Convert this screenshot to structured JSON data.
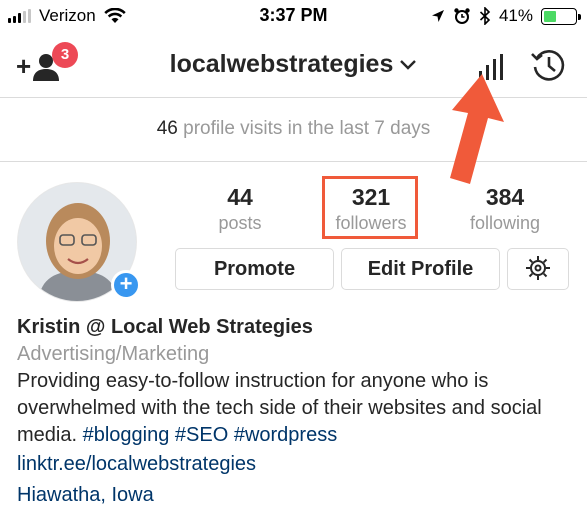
{
  "status_bar": {
    "carrier": "Verizon",
    "time": "3:37 PM",
    "battery_pct": "41%",
    "battery_level": 0.41,
    "battery_color": "#4cd964"
  },
  "nav": {
    "notification_count": "3",
    "username": "localwebstrategies"
  },
  "visits": {
    "count": "46",
    "label": " profile visits in the last 7 days"
  },
  "stats": {
    "posts": {
      "value": "44",
      "label": "posts"
    },
    "followers": {
      "value": "321",
      "label": "followers"
    },
    "following": {
      "value": "384",
      "label": "following"
    }
  },
  "buttons": {
    "promote": "Promote",
    "edit_profile": "Edit Profile"
  },
  "bio": {
    "name": "Kristin @ Local Web Strategies",
    "category": "Advertising/Marketing",
    "description": "Providing easy-to-follow instruction for anyone who is overwhelmed with the tech side of their websites and social media.",
    "hashtags": [
      "#blogging",
      "#SEO",
      "#wordpress"
    ],
    "link": "linktr.ee/localwebstrategies",
    "location": "Hiawatha, Iowa"
  },
  "colors": {
    "badge": "#ed4956",
    "link": "#003569",
    "highlight": "#f05a3a",
    "add_button": "#3897f0"
  },
  "icons": [
    "signal-icon",
    "wifi-icon",
    "location-arrow-icon",
    "alarm-icon",
    "bluetooth-icon",
    "battery-icon",
    "add-user-icon",
    "chevron-down-icon",
    "insights-icon",
    "history-icon",
    "plus-icon",
    "gear-icon"
  ]
}
